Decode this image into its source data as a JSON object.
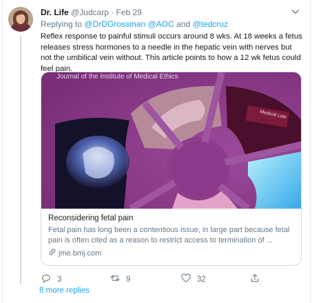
{
  "tweet": {
    "display_name": "Dr. Life",
    "handle": "@Judcarp",
    "separator": "·",
    "date": "Feb 29",
    "replying_prefix": "Replying to",
    "replying_to": [
      "@DrDGrossman",
      "@AOC",
      "@tedcruz"
    ],
    "replying_and": "and",
    "text": "Reflex response to painful stimuli occurs around 8 wks. At 18 weeks a fetus releases stress hormones to a needle in the hepatic vein with nerves but not the umbilical vein without. This article points to how a 12 wk fetus could feel pain."
  },
  "card": {
    "image_caption": "Journal of the Institute of Medical Ethics",
    "inner_label": "Medical Law",
    "title": "Reconsidering fetal pain",
    "description": "Fetal pain has long been a contentious issue, in large part because fetal pain is often cited as a reason to restrict access to termination of ...",
    "domain": "jme.bmj.com"
  },
  "actions": {
    "reply_count": "3",
    "retweet_count": "9",
    "like_count": "32"
  },
  "more_replies": "8 more replies",
  "colors": {
    "accent": "#1da1f2",
    "secondary_text": "#657786",
    "border": "#cfd9de",
    "card_purple": "#8c3f8a"
  },
  "icons": [
    "avatar",
    "chevron-down-icon",
    "reply-icon",
    "retweet-icon",
    "like-icon",
    "share-icon",
    "link-icon"
  ]
}
